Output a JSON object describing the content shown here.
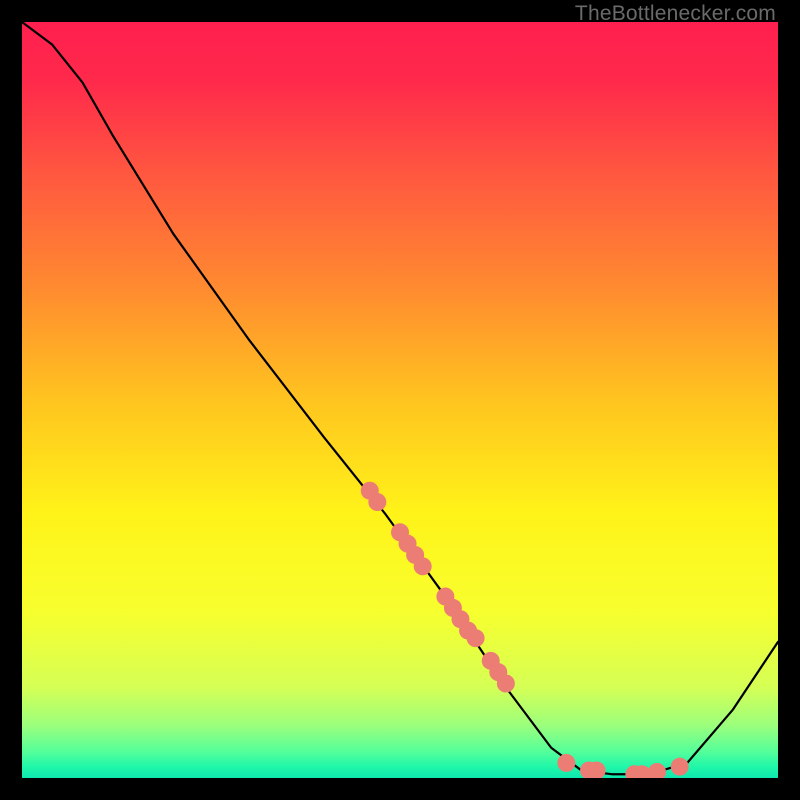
{
  "watermark": "TheBottlenecker.com",
  "chart_data": {
    "type": "line",
    "title": "",
    "xlabel": "",
    "ylabel": "",
    "xlim": [
      0,
      100
    ],
    "ylim": [
      0,
      100
    ],
    "grid": false,
    "background_gradient": {
      "stops": [
        {
          "offset": 0.0,
          "color": "#ff1f4f"
        },
        {
          "offset": 0.08,
          "color": "#ff2a4b"
        },
        {
          "offset": 0.2,
          "color": "#ff5740"
        },
        {
          "offset": 0.35,
          "color": "#ff8a30"
        },
        {
          "offset": 0.5,
          "color": "#ffc41f"
        },
        {
          "offset": 0.65,
          "color": "#fff319"
        },
        {
          "offset": 0.78,
          "color": "#f7ff2e"
        },
        {
          "offset": 0.88,
          "color": "#d5ff55"
        },
        {
          "offset": 0.93,
          "color": "#9cff7c"
        },
        {
          "offset": 0.965,
          "color": "#55ff9a"
        },
        {
          "offset": 0.985,
          "color": "#20f7a9"
        },
        {
          "offset": 1.0,
          "color": "#0de8b0"
        }
      ]
    },
    "curve": [
      {
        "x": 0,
        "y": 100
      },
      {
        "x": 4,
        "y": 97
      },
      {
        "x": 8,
        "y": 92
      },
      {
        "x": 12,
        "y": 85
      },
      {
        "x": 20,
        "y": 72
      },
      {
        "x": 30,
        "y": 58
      },
      {
        "x": 40,
        "y": 45
      },
      {
        "x": 48,
        "y": 35
      },
      {
        "x": 56,
        "y": 24
      },
      {
        "x": 64,
        "y": 12
      },
      {
        "x": 70,
        "y": 4
      },
      {
        "x": 74,
        "y": 1
      },
      {
        "x": 78,
        "y": 0.5
      },
      {
        "x": 83,
        "y": 0.5
      },
      {
        "x": 88,
        "y": 2
      },
      {
        "x": 94,
        "y": 9
      },
      {
        "x": 100,
        "y": 18
      }
    ],
    "data_points": [
      {
        "x": 46,
        "y": 38
      },
      {
        "x": 47,
        "y": 36.5
      },
      {
        "x": 50,
        "y": 32.5
      },
      {
        "x": 51,
        "y": 31
      },
      {
        "x": 52,
        "y": 29.5
      },
      {
        "x": 53,
        "y": 28
      },
      {
        "x": 56,
        "y": 24
      },
      {
        "x": 57,
        "y": 22.5
      },
      {
        "x": 58,
        "y": 21
      },
      {
        "x": 59,
        "y": 19.5
      },
      {
        "x": 60,
        "y": 18.5
      },
      {
        "x": 62,
        "y": 15.5
      },
      {
        "x": 63,
        "y": 14
      },
      {
        "x": 64,
        "y": 12.5
      },
      {
        "x": 72,
        "y": 2
      },
      {
        "x": 75,
        "y": 1
      },
      {
        "x": 76,
        "y": 1
      },
      {
        "x": 81,
        "y": 0.5
      },
      {
        "x": 82,
        "y": 0.5
      },
      {
        "x": 84,
        "y": 0.8
      },
      {
        "x": 87,
        "y": 1.5
      }
    ],
    "point_color": "#ec7d74",
    "point_radius": 9,
    "line_color": "#000000",
    "line_width": 2.2
  }
}
